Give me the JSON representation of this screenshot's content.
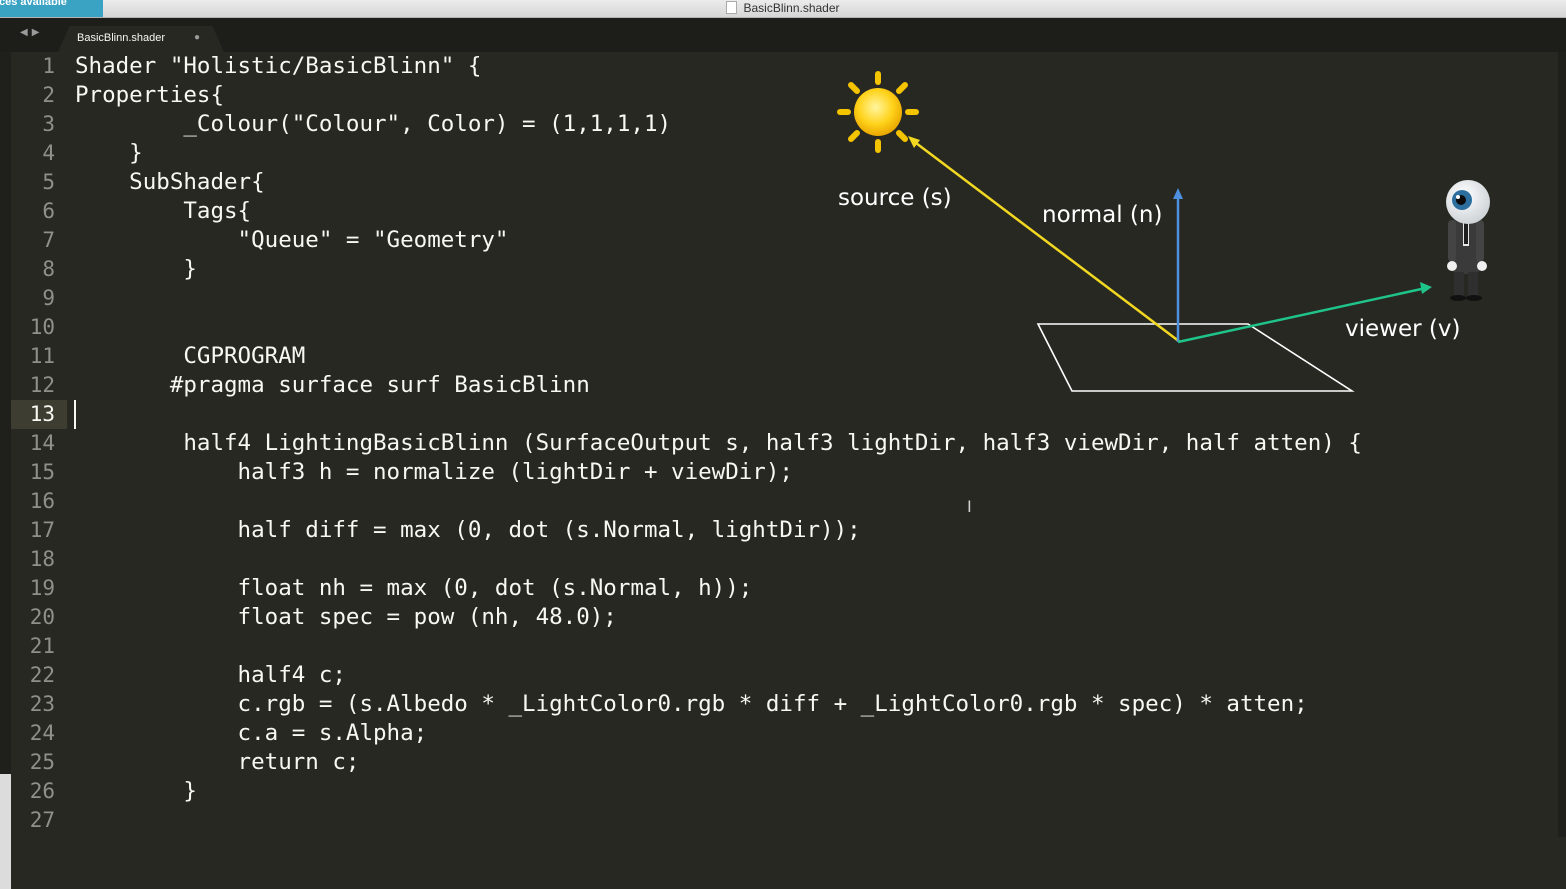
{
  "window": {
    "title": "BasicBlinn.shader"
  },
  "notification": {
    "text": "urces available"
  },
  "tabs": [
    {
      "label": "BasicBlinn.shader",
      "dirty_marker": "●"
    }
  ],
  "editor": {
    "active_line": 13,
    "gutter": [
      "1",
      "2",
      "3",
      "4",
      "5",
      "6",
      "7",
      "8",
      "9",
      "10",
      "11",
      "12",
      "13",
      "14",
      "15",
      "16",
      "17",
      "18",
      "19",
      "20",
      "21",
      "22",
      "23",
      "24",
      "25",
      "26",
      "27"
    ],
    "lines": [
      "Shader \"Holistic/BasicBlinn\" {",
      "Properties{",
      "        _Colour(\"Colour\", Color) = (1,1,1,1)",
      "    }",
      "    SubShader{",
      "        Tags{",
      "            \"Queue\" = \"Geometry\"",
      "        }",
      "",
      "",
      "        CGPROGRAM",
      "       #pragma surface surf BasicBlinn",
      "",
      "        half4 LightingBasicBlinn (SurfaceOutput s, half3 lightDir, half3 viewDir, half atten) {",
      "            half3 h = normalize (lightDir + viewDir);",
      "",
      "            half diff = max (0, dot (s.Normal, lightDir));",
      "",
      "            float nh = max (0, dot (s.Normal, h));",
      "            float spec = pow (nh, 48.0);",
      "",
      "            half4 c;",
      "            c.rgb = (s.Albedo * _LightColor0.rgb * diff + _LightColor0.rgb * spec) * atten;",
      "            c.a = s.Alpha;",
      "            return c;",
      "        }",
      ""
    ]
  },
  "diagram": {
    "labels": {
      "source": "source (s)",
      "normal": "normal (n)",
      "viewer": "viewer (v)"
    },
    "colors": {
      "source_ray": "#f2d821",
      "normal_ray": "#4f8fe0",
      "viewer_ray": "#1fc48a",
      "plane": "#ffffff"
    },
    "icons": [
      "sun-icon",
      "eyeball-viewer-icon"
    ]
  },
  "colors": {
    "editor_bg": "#272822",
    "text": "#f8f8f2",
    "gutter_text": "#8f908a"
  }
}
